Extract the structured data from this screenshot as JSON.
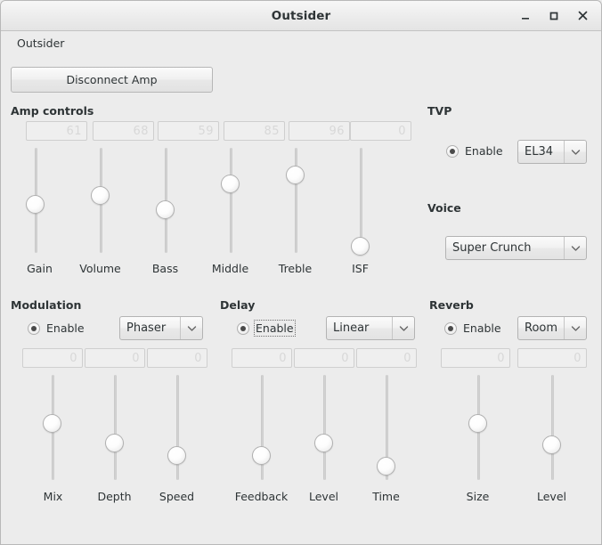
{
  "window": {
    "title": "Outsider",
    "minimize_label": "minimize",
    "maximize_label": "maximize",
    "close_label": "close"
  },
  "menubar": {
    "items": [
      {
        "label": "Outsider"
      }
    ]
  },
  "toolbar": {
    "disconnect_label": "Disconnect Amp"
  },
  "amp_controls": {
    "title": "Amp controls",
    "sliders": [
      {
        "label": "Gain",
        "value": "61"
      },
      {
        "label": "Volume",
        "value": "68"
      },
      {
        "label": "Bass",
        "value": "59"
      },
      {
        "label": "Middle",
        "value": "85"
      },
      {
        "label": "Treble",
        "value": "96"
      },
      {
        "label": "ISF",
        "value": "0"
      }
    ]
  },
  "tvp": {
    "title": "TVP",
    "enable_label": "Enable",
    "enabled": true,
    "valve_selected": "EL34"
  },
  "voice": {
    "title": "Voice",
    "selected": "Super Crunch"
  },
  "modulation": {
    "title": "Modulation",
    "enable_label": "Enable",
    "enabled": true,
    "type_selected": "Phaser",
    "sliders": [
      {
        "label": "Mix",
        "value": "0"
      },
      {
        "label": "Depth",
        "value": "0"
      },
      {
        "label": "Speed",
        "value": "0"
      }
    ]
  },
  "delay": {
    "title": "Delay",
    "enable_label": "Enable",
    "enabled": true,
    "type_selected": "Linear",
    "sliders": [
      {
        "label": "Feedback",
        "value": "0"
      },
      {
        "label": "Level",
        "value": "0"
      },
      {
        "label": "Time",
        "value": "0"
      }
    ]
  },
  "reverb": {
    "title": "Reverb",
    "enable_label": "Enable",
    "enabled": true,
    "type_selected": "Room",
    "sliders": [
      {
        "label": "Size",
        "value": "0"
      },
      {
        "label": "Level",
        "value": "0"
      }
    ]
  },
  "colors": {
    "window_bg": "#ececec",
    "text": "#2e3436",
    "spin_value": "#d8d8d8",
    "border": "#b3b3b3"
  }
}
